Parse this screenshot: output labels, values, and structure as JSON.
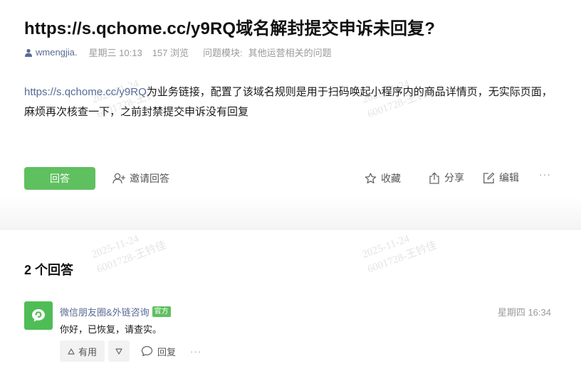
{
  "question": {
    "title": "https://s.qchome.cc/y9RQ域名解封提交申诉未回复?",
    "author": "wmengjia.",
    "date": "星期三 10:13",
    "views": "157 浏览",
    "module_label": "问题模块:",
    "module": "其他运营相关的问题",
    "body_link": "https://s.qchome.cc/y9RQ",
    "body_line1_rest": "为业务链接，配置了该域名规则是用于扫码唤起小程序内的商品详情页，无实际页面，",
    "body_line2": "麻烦再次核查一下，之前封禁提交申诉没有回复"
  },
  "actions": {
    "answer": "回答",
    "invite": "邀请回答",
    "favorite": "收藏",
    "share": "分享",
    "edit": "编辑",
    "more": "···"
  },
  "answers": {
    "count_label": "2 个回答",
    "items": [
      {
        "name": "微信朋友圈&外链咨询",
        "badge": "官方",
        "time": "星期四 16:34",
        "text": "你好，已恢复，请查实。",
        "useful": "有用",
        "reply": "回复",
        "more": "···"
      }
    ]
  },
  "watermark": {
    "date": "2025-11-24",
    "id": "6001728-王钤佳"
  },
  "colors": {
    "accent_green": "#5fc05f",
    "link_blue": "#576b95",
    "meta_gray": "#9a9a9a"
  }
}
